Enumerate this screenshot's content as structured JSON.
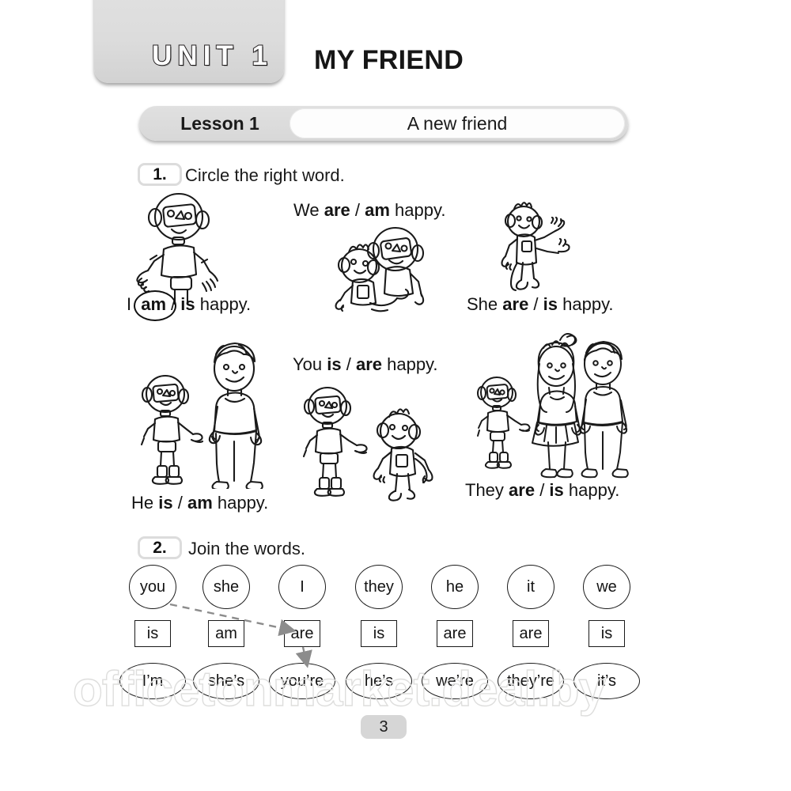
{
  "unit": {
    "tab_label": "UNIT 1",
    "title": "MY FRIEND"
  },
  "lesson": {
    "label": "Lesson 1",
    "title": "A new friend"
  },
  "exercises": [
    {
      "number": "1.",
      "instruction": "Circle the right word.",
      "sentences": [
        {
          "id": "i-am",
          "pre": "I ",
          "opt1": "am",
          "opt2": "is",
          "post": " happy.",
          "circled": "opt1"
        },
        {
          "id": "we-are",
          "pre": "We ",
          "opt1": "are",
          "opt2": "am",
          "post": " happy.",
          "circled": "none"
        },
        {
          "id": "she-are",
          "pre": "She ",
          "opt1": "are",
          "opt2": "is",
          "post": " happy.",
          "circled": "none"
        },
        {
          "id": "you-is",
          "pre": "You ",
          "opt1": "is",
          "opt2": "are",
          "post": " happy.",
          "circled": "none"
        },
        {
          "id": "he-is",
          "pre": "He ",
          "opt1": "is",
          "opt2": "am",
          "post": " happy.",
          "circled": "none"
        },
        {
          "id": "they-are",
          "pre": "They ",
          "opt1": "are",
          "opt2": "is",
          "post": " happy.",
          "circled": "none"
        }
      ]
    },
    {
      "number": "2.",
      "instruction": "Join the words.",
      "row_pronouns": [
        "you",
        "she",
        "I",
        "they",
        "he",
        "it",
        "we"
      ],
      "row_verbs": [
        "is",
        "am",
        "are",
        "is",
        "are",
        "are",
        "is"
      ],
      "row_contractions": [
        "I’m",
        "she’s",
        "you’re",
        "he’s",
        "we’re",
        "they’re",
        "it’s"
      ],
      "drawn_answer": {
        "from": "you",
        "to_verb": "are",
        "to_contraction": "you’re"
      }
    }
  ],
  "watermark": "officetonmarket.deal.by",
  "page_number": "3",
  "colors": {
    "tab_gray": "#dcdcdc",
    "ink": "#141414",
    "arrow_gray": "#8c8c8c",
    "watermark": "#dededd",
    "page_badge": "#d6d6d6"
  },
  "illustrations": [
    {
      "name": "robot-thumbs-up",
      "caption": "I am / is happy."
    },
    {
      "name": "robot-and-monkey-hugging",
      "caption": "We are / am happy."
    },
    {
      "name": "monkey-waving",
      "caption": "She are / is happy."
    },
    {
      "name": "robot-and-boy",
      "caption": "He is / am happy."
    },
    {
      "name": "robot-and-monkey-pointing",
      "caption": "You is / are happy."
    },
    {
      "name": "robot-girl-and-boy-group",
      "caption": "They are / is happy."
    }
  ]
}
